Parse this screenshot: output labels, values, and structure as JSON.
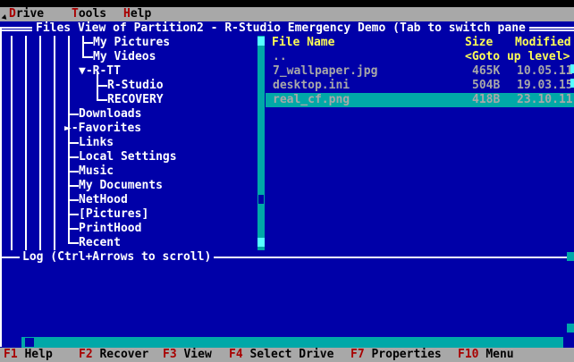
{
  "menubar": {
    "items": [
      {
        "hot": "D",
        "rest": "rive"
      },
      {
        "hot": "T",
        "rest": "ools"
      },
      {
        "hot": "H",
        "rest": "elp"
      }
    ]
  },
  "panel": {
    "title": "Files View of Partition2 - R-Studio Emergency Demo (Tab to switch pane"
  },
  "tree": {
    "items": [
      {
        "label": "My Pictures"
      },
      {
        "label": "My Videos"
      },
      {
        "label": "R-TT",
        "marker": "▼"
      },
      {
        "label": "R-Studio"
      },
      {
        "label": "RECOVERY"
      },
      {
        "label": "Downloads"
      },
      {
        "label": "Favorites",
        "marker": "►"
      },
      {
        "label": "Links"
      },
      {
        "label": "Local Settings"
      },
      {
        "label": "Music"
      },
      {
        "label": "My Documents"
      },
      {
        "label": "NetHood"
      },
      {
        "label": "[Pictures]"
      },
      {
        "label": "PrintHood"
      },
      {
        "label": "Recent"
      }
    ]
  },
  "files": {
    "headers": {
      "name": "File Name",
      "size": "Size",
      "modified": "Modified"
    },
    "rows": [
      {
        "name": "..",
        "size": "<Goto up level>",
        "modified": ""
      },
      {
        "name": "7_wallpaper.jpg",
        "size": "465K",
        "modified": "10.05.11"
      },
      {
        "name": "desktop.ini",
        "size": "504B",
        "modified": "19.03.15"
      },
      {
        "name": "real_cf.png",
        "size": "418B",
        "modified": "23.10.11",
        "selected": true
      }
    ]
  },
  "log": {
    "label": "Log (Ctrl+Arrows to scroll)"
  },
  "fkeys": [
    {
      "key": "F1",
      "label": "Help"
    },
    {
      "key": "F2",
      "label": "Recover"
    },
    {
      "key": "F3",
      "label": "View"
    },
    {
      "key": "F4",
      "label": "Select Drive"
    },
    {
      "key": "F7",
      "label": "Properties"
    },
    {
      "key": "F10",
      "label": "Menu"
    }
  ],
  "colors": {
    "background": "#0000a8",
    "accent": "#00a8a8",
    "header_text": "#ffff55",
    "hotkey": "#a80000",
    "bar": "#a8a8a8"
  }
}
